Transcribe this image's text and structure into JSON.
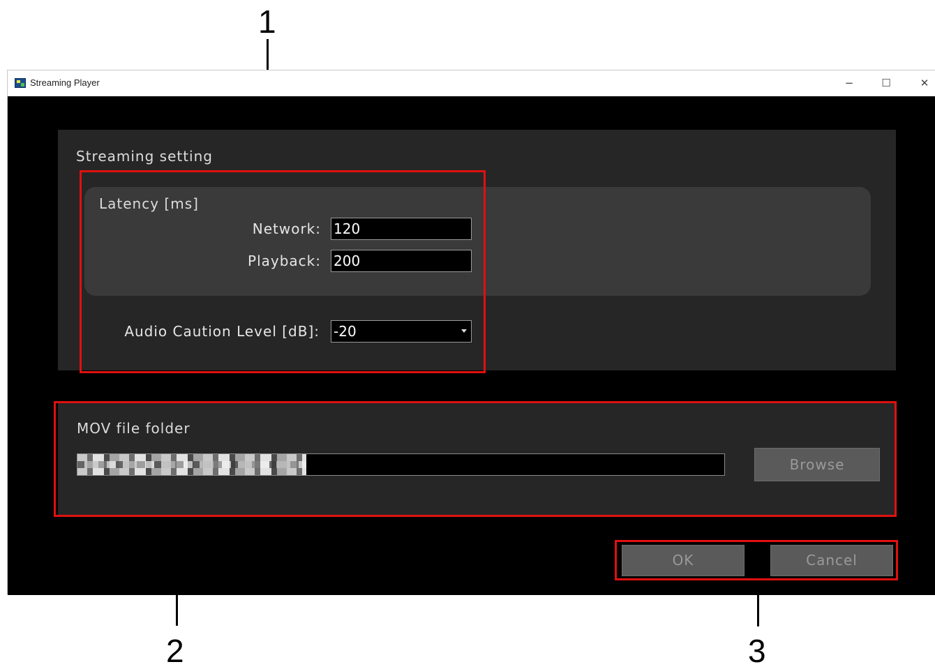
{
  "callouts": {
    "one": "1",
    "two": "2",
    "three": "3"
  },
  "window": {
    "title": "Streaming Player",
    "minimize": "−",
    "maximize": "☐",
    "close": "✕"
  },
  "streaming": {
    "heading": "Streaming setting",
    "latency_heading": "Latency [ms]",
    "network_label": "Network:",
    "network_value": "120",
    "playback_label": "Playback:",
    "playback_value": "200",
    "audio_label": "Audio Caution Level [dB]:",
    "audio_value": "-20"
  },
  "mov": {
    "heading": "MOV file folder",
    "browse_label": "Browse"
  },
  "actions": {
    "ok_label": "OK",
    "cancel_label": "Cancel"
  },
  "colors": {
    "callout_red": "#e01010",
    "panel": "#262626",
    "group": "#3a3a3a"
  }
}
